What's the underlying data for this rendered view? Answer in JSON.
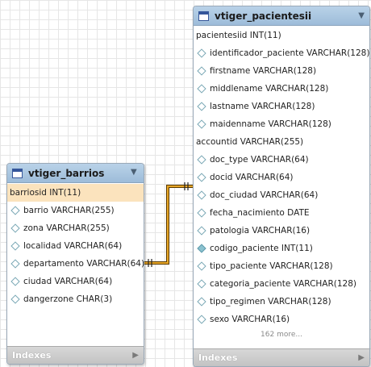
{
  "barrios": {
    "title": "vtiger_barrios",
    "fields": [
      {
        "text": "barriosid INT(11)",
        "kind": "pk"
      },
      {
        "text": "barrio VARCHAR(255)",
        "kind": "col"
      },
      {
        "text": "zona VARCHAR(255)",
        "kind": "col"
      },
      {
        "text": "localidad VARCHAR(64)",
        "kind": "col"
      },
      {
        "text": "departamento VARCHAR(64)",
        "kind": "col"
      },
      {
        "text": "ciudad VARCHAR(64)",
        "kind": "col"
      },
      {
        "text": "dangerzone CHAR(3)",
        "kind": "col"
      }
    ],
    "indexes_label": "Indexes"
  },
  "pacientes": {
    "title": "vtiger_pacientesii",
    "fields": [
      {
        "text": "pacientesiid INT(11)",
        "kind": "key"
      },
      {
        "text": "identificador_paciente VARCHAR(128)",
        "kind": "col"
      },
      {
        "text": "firstname VARCHAR(128)",
        "kind": "col"
      },
      {
        "text": "middlename VARCHAR(128)",
        "kind": "col"
      },
      {
        "text": "lastname VARCHAR(128)",
        "kind": "col"
      },
      {
        "text": "maidenname VARCHAR(128)",
        "kind": "col"
      },
      {
        "text": "accountid VARCHAR(255)",
        "kind": "key"
      },
      {
        "text": "doc_type VARCHAR(64)",
        "kind": "col"
      },
      {
        "text": "docid VARCHAR(64)",
        "kind": "col"
      },
      {
        "text": "doc_ciudad VARCHAR(64)",
        "kind": "col"
      },
      {
        "text": "fecha_nacimiento DATE",
        "kind": "col"
      },
      {
        "text": "patologia VARCHAR(16)",
        "kind": "col"
      },
      {
        "text": "codigo_paciente INT(11)",
        "kind": "idx"
      },
      {
        "text": "tipo_paciente VARCHAR(128)",
        "kind": "col"
      },
      {
        "text": "categoria_paciente VARCHAR(128)",
        "kind": "col"
      },
      {
        "text": "tipo_regimen VARCHAR(128)",
        "kind": "col"
      },
      {
        "text": "sexo VARCHAR(16)",
        "kind": "col"
      }
    ],
    "more_label": "162 more...",
    "indexes_label": "Indexes"
  },
  "colors": {
    "relationship": "#c98a12",
    "primary_key_row": "#fbe3bd",
    "header": "#a9c6e1"
  }
}
